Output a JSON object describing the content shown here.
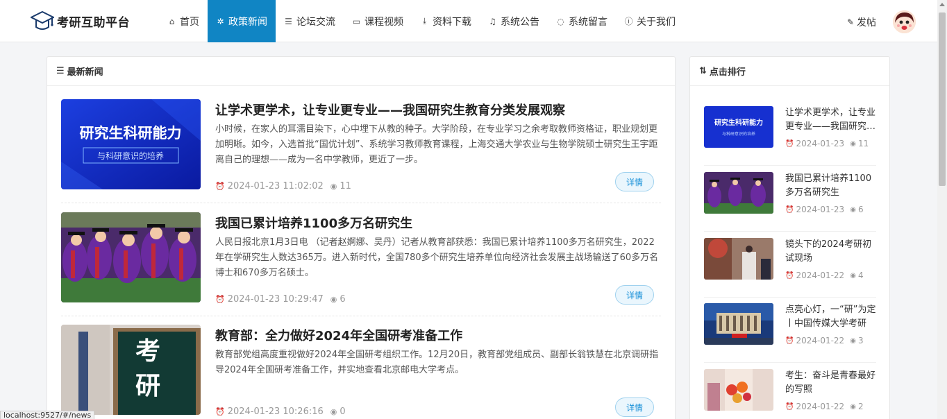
{
  "header": {
    "logo_text": "考研互助平台",
    "nav": [
      {
        "icon": "home-icon",
        "glyph": "⌂",
        "label": "首页",
        "active": false
      },
      {
        "icon": "gear-icon",
        "glyph": "✲",
        "label": "政策新闻",
        "active": true
      },
      {
        "icon": "chat-icon",
        "glyph": "☰",
        "label": "论坛交流",
        "active": false
      },
      {
        "icon": "video-icon",
        "glyph": "▭",
        "label": "课程视频",
        "active": false
      },
      {
        "icon": "download-icon",
        "glyph": "⤓",
        "label": "资料下载",
        "active": false
      },
      {
        "icon": "bell-icon",
        "glyph": "♫",
        "label": "系统公告",
        "active": false
      },
      {
        "icon": "message-icon",
        "glyph": "◌",
        "label": "系统留言",
        "active": false
      },
      {
        "icon": "info-icon",
        "glyph": "ⓘ",
        "label": "关于我们",
        "active": false
      }
    ],
    "post_label": "发帖"
  },
  "news": {
    "heading": "最新新闻",
    "detail_label": "详情",
    "items": [
      {
        "title": "让学术更学术，让专业更专业——我国研究生教育分类发展观察",
        "desc": "小时候，在家人的耳濡目染下，心中埋下从教的种子。大学阶段，在专业学习之余考取教师资格证，职业规划更加明晰。如今，入选首批“国优计划”、系统学习教师教育课程，上海交通大学农业与生物学院硕士研究生王宇距离自己的理想——成为一名中学教师，更近了一步。",
        "time": "2024-01-23 11:02:02",
        "views": "11",
        "thumb_text": "研究生科研能力",
        "thumb_sub": "与科研意识的培养"
      },
      {
        "title": "我国已累计培养1100多万名研究生",
        "desc": "人民日报北京1月3日电 （记者赵婀娜、吴丹）记者从教育部获悉：我国已累计培养1100多万名研究生，2022年在学研究生人数达365万。进入新时代，全国780多个研究生培养单位向经济社会发展主战场输送了60多万名博士和670多万名硕士。",
        "time": "2024-01-23 10:29:47",
        "views": "6"
      },
      {
        "title": "教育部：全力做好2024年全国研考准备工作",
        "desc": "教育部党组高度重视做好2024年全国研考组织工作。12月20日，教育部党组成员、副部长翁铁慧在北京调研指导2024年全国研考准备工作，并实地查看北京邮电大学考点。",
        "time": "2024-01-23 10:26:16",
        "views": "0",
        "thumb_text": "考研"
      }
    ]
  },
  "ranking": {
    "heading": "点击排行",
    "items": [
      {
        "title": "让学术更学术，让专业更专业——我国研究生教育分类发展观察",
        "date": "2024-01-23",
        "views": "11",
        "thumb_text": "研究生科研能力",
        "thumb_sub": "与科研意识的培养"
      },
      {
        "title": "我国已累计培养1100多万名研究生",
        "date": "2024-01-23",
        "views": "6"
      },
      {
        "title": "镜头下的2024考研初试现场",
        "date": "2024-01-22",
        "views": "4"
      },
      {
        "title": "点亮心灯，一“研”为定丨中国传媒大学考研",
        "date": "2024-01-22",
        "views": "3"
      },
      {
        "title": "考生：奋斗是青春最好的写照",
        "date": "2024-01-22",
        "views": "2"
      }
    ]
  },
  "status_url": "localhost:9527/#/news"
}
